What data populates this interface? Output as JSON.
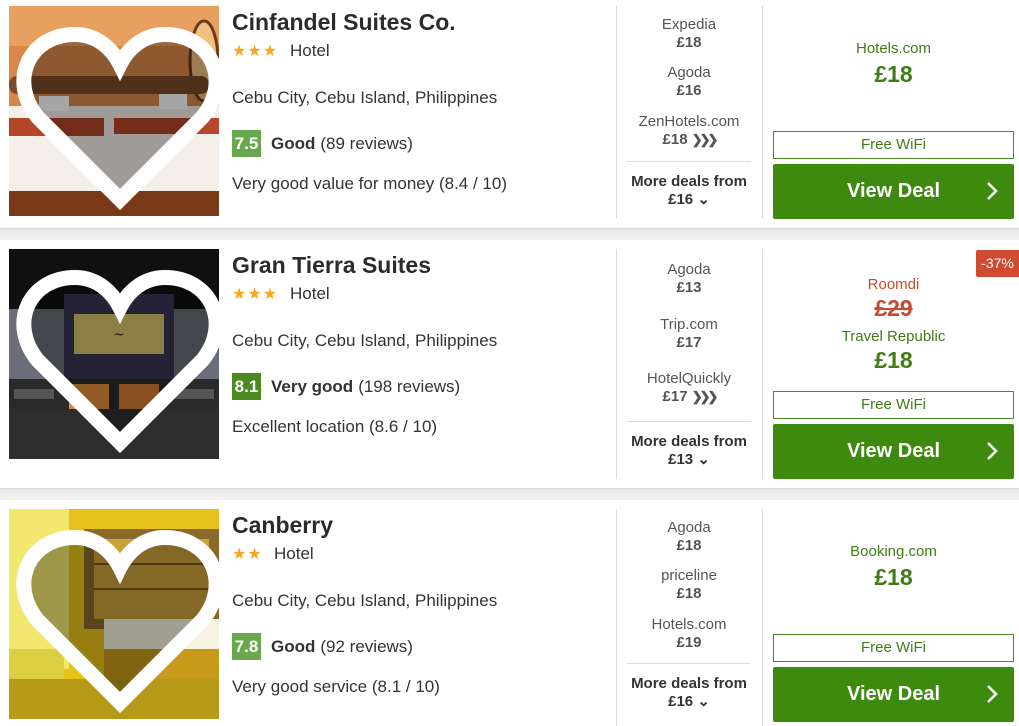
{
  "colors": {
    "accent": "#3e8a0f",
    "deal_text": "#3f7d16",
    "old_price": "#c9492e",
    "discount": "#d04a32",
    "stars": "#f6a623"
  },
  "hotels": [
    {
      "name": "Cinfandel Suites Co.",
      "stars": "★★★",
      "star_count": 3,
      "type": "Hotel",
      "location": "Cebu City, Cebu Island, Philippines",
      "score": "7.5",
      "rating_word": "Good",
      "reviews": "(89 reviews)",
      "highlight": "Very good value for money (8.4 / 10)",
      "deals": [
        {
          "site": "Expedia",
          "price": "£18"
        },
        {
          "site": "Agoda",
          "price": "£16"
        },
        {
          "site": "ZenHotels.com",
          "price": "£18",
          "chevrons": "❯❯❯"
        }
      ],
      "more_label": "More deals from",
      "more_price": "£16",
      "best_site": "Hotels.com",
      "best_price": "£18",
      "amenity": "Free WiFi",
      "cta": "View Deal"
    },
    {
      "name": "Gran Tierra Suites",
      "stars": "★★★",
      "star_count": 3,
      "type": "Hotel",
      "location": "Cebu City, Cebu Island, Philippines",
      "score": "8.1",
      "rating_word": "Very good",
      "reviews": "(198 reviews)",
      "highlight": "Excellent location (8.6 / 10)",
      "deals": [
        {
          "site": "Agoda",
          "price": "£13"
        },
        {
          "site": "Trip.com",
          "price": "£17"
        },
        {
          "site": "HotelQuickly",
          "price": "£17",
          "chevrons": "❯❯❯"
        }
      ],
      "more_label": "More deals from",
      "more_price": "£13",
      "discount": "-37%",
      "old_site": "Roomdi",
      "old_price": "£29",
      "best_site": "Travel Republic",
      "best_price": "£18",
      "amenity": "Free WiFi",
      "cta": "View Deal"
    },
    {
      "name": "Canberry",
      "stars": "★★",
      "star_count": 2,
      "type": "Hotel",
      "location": "Cebu City, Cebu Island, Philippines",
      "score": "7.8",
      "rating_word": "Good",
      "reviews": "(92 reviews)",
      "highlight": "Very good service (8.1 / 10)",
      "deals": [
        {
          "site": "Agoda",
          "price": "£18"
        },
        {
          "site": "priceline",
          "price": "£18"
        },
        {
          "site": "Hotels.com",
          "price": "£19"
        }
      ],
      "more_label": "More deals from",
      "more_price": "£16",
      "best_site": "Booking.com",
      "best_price": "£18",
      "amenity": "Free WiFi",
      "cta": "View Deal"
    }
  ]
}
